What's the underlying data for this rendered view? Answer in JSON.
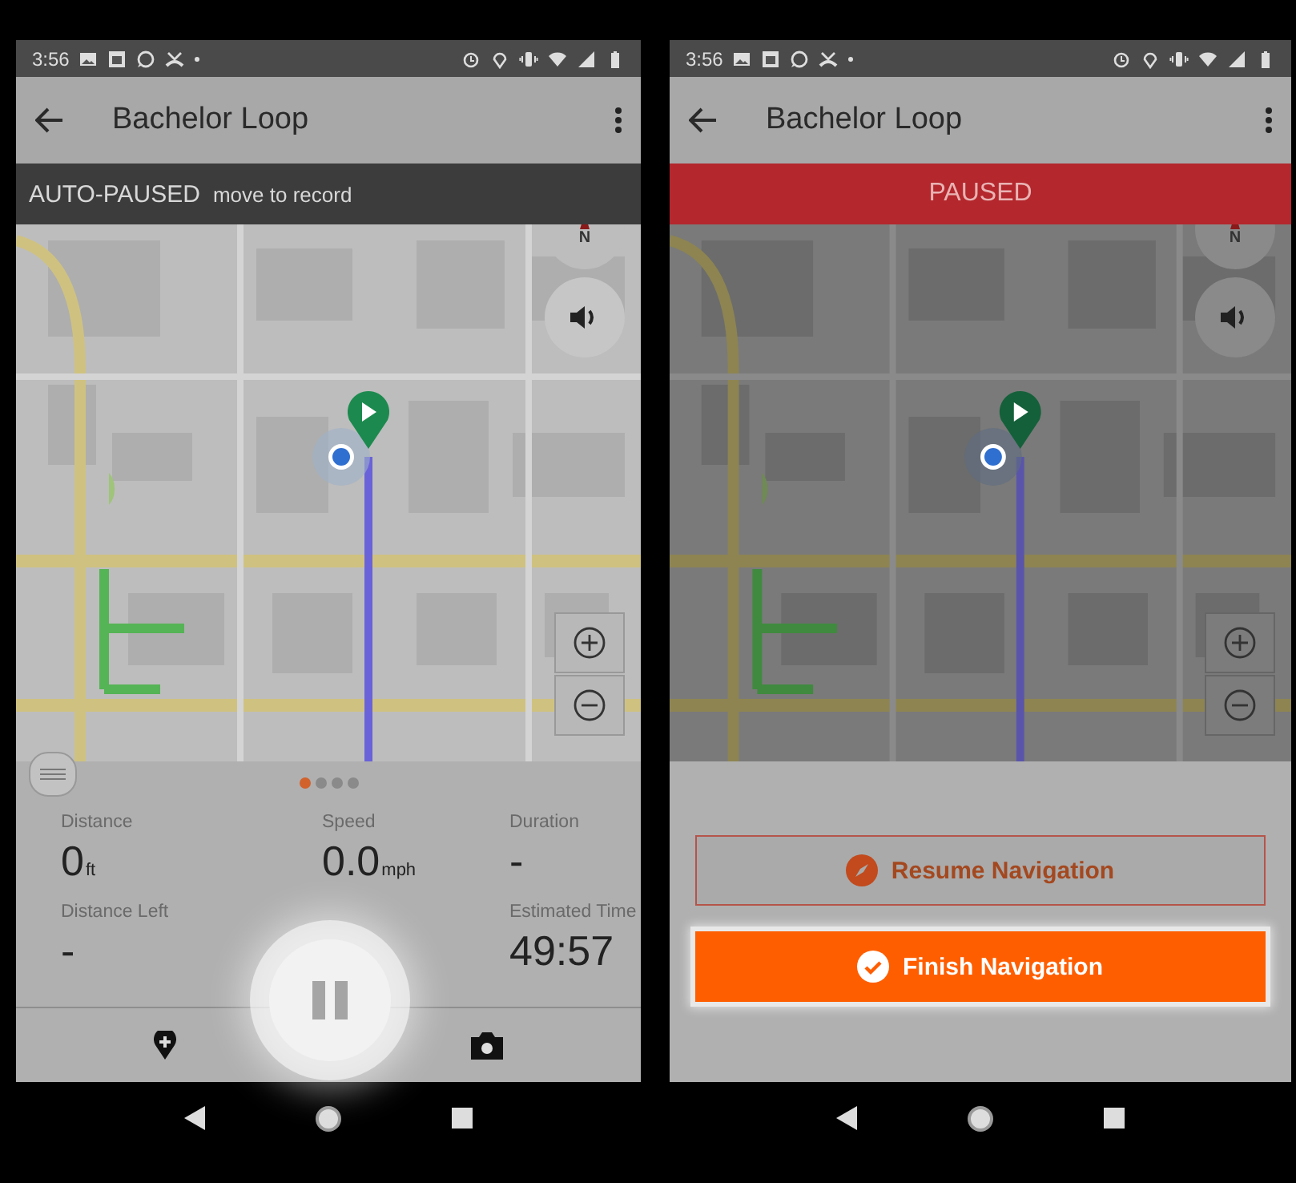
{
  "phones": [
    {
      "kind": "tracking",
      "status_bar": {
        "time": "3:56"
      },
      "app_bar": {
        "title": "Bachelor Loop"
      },
      "banner": {
        "kind": "dark",
        "label": "AUTO-PAUSED",
        "hint": "move to record"
      },
      "compass": {
        "label": "N"
      },
      "page_dots": [
        {
          "selected": true
        },
        {
          "selected": false
        },
        {
          "selected": false
        },
        {
          "selected": false
        }
      ],
      "stats": [
        {
          "label": "Distance",
          "value": "0",
          "unit": "ft"
        },
        {
          "label": "Speed",
          "value": "0.0",
          "unit": "mph"
        },
        {
          "label": "Duration",
          "value": "-"
        },
        {
          "label": "Distance Left",
          "value": "-"
        },
        {
          "label": "Estimated Time",
          "value": "49:57"
        }
      ]
    },
    {
      "kind": "menu",
      "status_bar": {
        "time": "3:56"
      },
      "app_bar": {
        "title": "Bachelor Loop"
      },
      "banner": {
        "kind": "alert",
        "label": "PAUSED"
      },
      "compass": {
        "label": "N"
      },
      "buttons": [
        {
          "kind": "outline",
          "label": "Resume Navigation"
        },
        {
          "kind": "filled",
          "label": "Finish Navigation"
        }
      ]
    }
  ]
}
